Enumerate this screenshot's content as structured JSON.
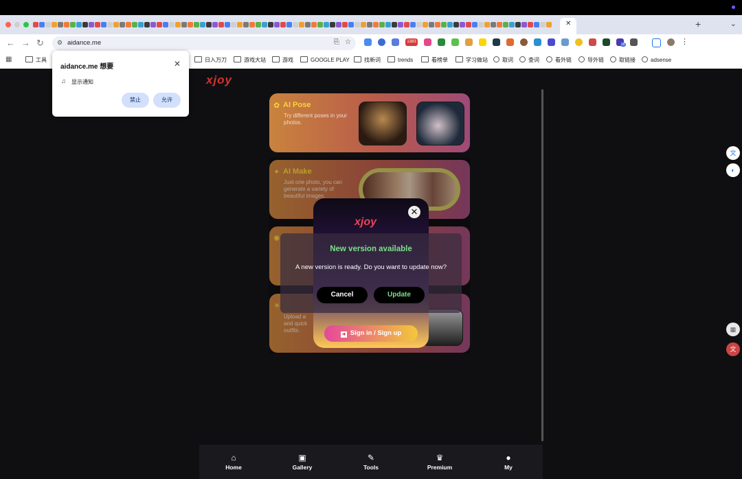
{
  "browser": {
    "url": "aidance.me",
    "download_badge": "18",
    "ext_badge": "1383",
    "bookmarks": [
      "工具",
      "日入万刀",
      "游戏大站",
      "游戏",
      "GOOGLE PLAY",
      "找新词",
      "trends",
      "看榜单",
      "学习做站",
      "取词",
      "查词",
      "看外链",
      "导外链",
      "取链接",
      "adsense"
    ]
  },
  "notification": {
    "title": "aidance.me 想要",
    "body": "显示通知",
    "block": "禁止",
    "allow": "允许",
    "close": "✕"
  },
  "app": {
    "logo": "xjoy",
    "cards": [
      {
        "title": "AI Pose",
        "desc": "Try different poses in your photos."
      },
      {
        "title": "AI Make",
        "desc": "Just one photo, you can generate a variety of beautiful images."
      },
      {
        "title": "",
        "desc": ""
      },
      {
        "title": "",
        "desc": "Upload a and quick outfits."
      }
    ],
    "nav": [
      {
        "label": "Home",
        "icon": "home-icon"
      },
      {
        "label": "Gallery",
        "icon": "gallery-icon"
      },
      {
        "label": "Tools",
        "icon": "tools-icon"
      },
      {
        "label": "Premium",
        "icon": "crown-icon"
      },
      {
        "label": "My",
        "icon": "user-icon"
      }
    ]
  },
  "login_modal": {
    "logo": "xjoy",
    "signin": "Sign in / Sign up",
    "close": "✕"
  },
  "update_dialog": {
    "title": "New version available",
    "message": "A new version is ready. Do you want to update now?",
    "cancel": "Cancel",
    "update": "Update"
  },
  "colors": {
    "accent_green": "#7de08a",
    "brand_red": "#d4322f",
    "title_yellow": "#f6d43a"
  }
}
